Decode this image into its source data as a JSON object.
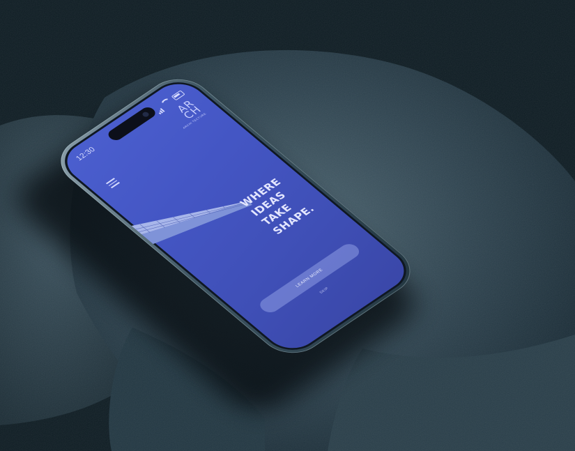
{
  "status_bar": {
    "time": "12:30"
  },
  "brand": {
    "logo_mark_top": "AR",
    "logo_mark_bottom": "CH",
    "tagline": "ARCHI TECTURE"
  },
  "hero": {
    "headline_lines": [
      "WHERE",
      "IDEAS",
      "TAKE",
      "SHAPE."
    ]
  },
  "actions": {
    "primary_label": "LEARN MORE",
    "secondary_label": "SKIP"
  },
  "colors": {
    "screen_blue": "#4456c4",
    "rock": "#2f4450",
    "background": "#0d1a20"
  },
  "icons": {
    "menu": "hamburger-icon",
    "signal": "signal-icon",
    "wifi": "wifi-icon",
    "battery": "battery-icon"
  }
}
